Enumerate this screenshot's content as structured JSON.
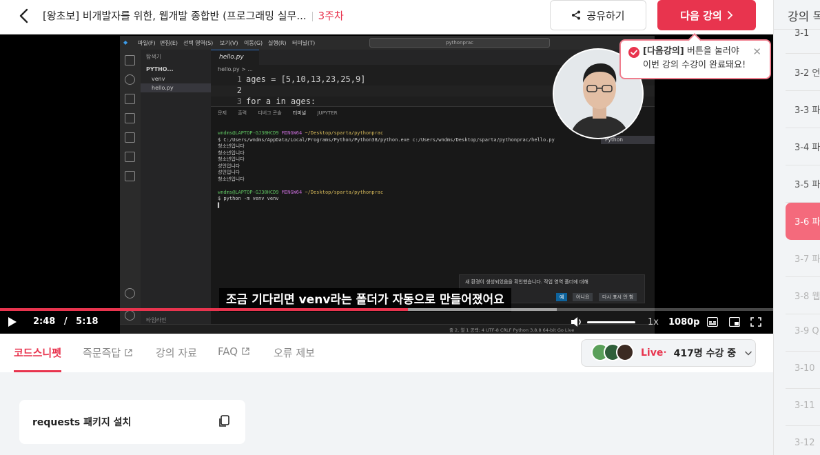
{
  "header": {
    "course_title": "[왕초보] 비개발자를 위한, 웹개발 종합반 (프로그래밍 실무...",
    "week": "3주차",
    "share_label": "공유하기",
    "next_label": "다음 강의"
  },
  "tooltip": {
    "bold": "[다음강의]",
    "line1_rest": " 버튼을 눌러야",
    "line2": "이번 강의 수강이 완료돼요!"
  },
  "vscode": {
    "menu": [
      "파일(F)",
      "편집(E)",
      "선택 영역(S)",
      "보기(V)",
      "이동(G)",
      "실행(R)",
      "터미널(T)"
    ],
    "search": "pythonprac",
    "explorer_title": "탐색기",
    "project": "PYTHO...",
    "files": [
      "venv",
      "hello.py"
    ],
    "tab": "hello.py",
    "breadcrumb": "hello.py > ...",
    "code_lines": [
      {
        "n": "1",
        "t": "ages = [5,10,13,23,25,9]"
      },
      {
        "n": "2",
        "t": ""
      },
      {
        "n": "3",
        "t": "for a in ages:"
      }
    ],
    "panel_tabs": [
      "문제",
      "출력",
      "디버그 콘솔",
      "터미널",
      "JUPYTER"
    ],
    "terminal": [
      {
        "c": "g",
        "t": "wndms@LAPTOP-GJ30HCD9 "
      },
      {
        "c": "",
        "t": "$ C:/Users/wndms/AppData/Local/Programs/Python/Python38/python.exe c:/Users/wndms/Desktop/sparta/pythonprac/hello.py"
      },
      {
        "c": "",
        "t": "청소년입니다"
      },
      {
        "c": "",
        "t": "청소년입니다"
      },
      {
        "c": "",
        "t": "청소년입니다"
      },
      {
        "c": "",
        "t": "성인입니다"
      },
      {
        "c": "",
        "t": "성인입니다"
      },
      {
        "c": "",
        "t": "청소년입니다"
      },
      {
        "c": "",
        "t": ""
      },
      {
        "c": "g",
        "t": "wndms@LAPTOP-GJ30HCD9 "
      },
      {
        "c": "",
        "t": "$ python -m venv venv"
      }
    ],
    "term_shell": "MINGW64",
    "term_path": "~/Desktop/sparta/pythonprac",
    "term_list": [
      "Python",
      "Python"
    ],
    "notify_text": "새 환경이 생성되었음을 확인했습니다. 작업 영역 폴더에 대해",
    "notify_buttons": [
      "예",
      "아니요",
      "다시 표시 안 함"
    ],
    "status": "줄 2, 열 1   공백: 4   UTF-8   CRLF   Python   3.8.8 64-bit   Go Live",
    "timeline": "타임라인"
  },
  "video": {
    "subtitle": "조금 기다리면 venv라는 폴더가 자동으로 만들어졌어요",
    "current_time": "2:48",
    "separator": "/",
    "duration": "5:18",
    "progress_fraction": 0.528,
    "buffered_fraction": 0.72,
    "speed": "1x",
    "quality": "1080p"
  },
  "tabs": {
    "items": [
      "코드스니펫",
      "즉문즉답",
      "강의 자료",
      "FAQ",
      "오류 제보"
    ],
    "active": "코드스니펫"
  },
  "live": {
    "label": "Live",
    "dot": "•",
    "count": "417명 수강 중"
  },
  "snippet": {
    "title": "requests 패키지 설치"
  },
  "sidebar": {
    "title": "강의 목",
    "lessons": [
      {
        "num": "3-1",
        "label": "",
        "state": "normal"
      },
      {
        "num": "3-2",
        "label": "언",
        "state": "normal"
      },
      {
        "num": "3-3",
        "label": "파",
        "state": "normal"
      },
      {
        "num": "3-4",
        "label": "파",
        "state": "normal"
      },
      {
        "num": "3-5",
        "label": "파",
        "state": "normal"
      },
      {
        "num": "3-6",
        "label": "파",
        "state": "active"
      },
      {
        "num": "3-7",
        "label": "파",
        "state": "dim"
      },
      {
        "num": "3-8",
        "label": "웹",
        "state": "dim"
      },
      {
        "num": "3-9",
        "label": "Q",
        "state": "dim"
      },
      {
        "num": "3-10",
        "label": "",
        "state": "dim"
      },
      {
        "num": "3-11",
        "label": "",
        "state": "dim"
      },
      {
        "num": "3-12",
        "label": "",
        "state": "dim"
      }
    ]
  },
  "colors": {
    "accent": "#e8344e",
    "active_lesson": "#f46a7c"
  }
}
